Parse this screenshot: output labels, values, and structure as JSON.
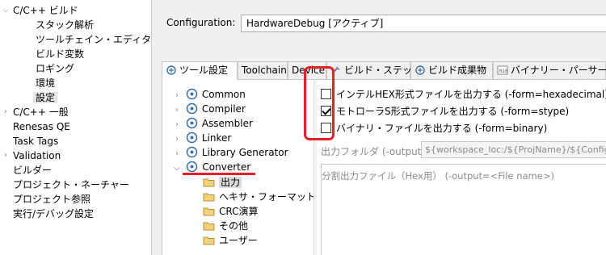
{
  "left_tree": {
    "items": [
      {
        "label": "C/C++ ビルド",
        "expanded": true
      },
      {
        "label": "スタック解析"
      },
      {
        "label": "ツールチェイン・エディター"
      },
      {
        "label": "ビルド変数"
      },
      {
        "label": "ロギング"
      },
      {
        "label": "環境"
      },
      {
        "label": "設定",
        "selected": true
      },
      {
        "label": "C/C++ 一般"
      },
      {
        "label": "Renesas QE"
      },
      {
        "label": "Task Tags"
      },
      {
        "label": "Validation"
      },
      {
        "label": "ビルダー"
      },
      {
        "label": "プロジェクト・ネーチャー"
      },
      {
        "label": "プロジェクト参照"
      },
      {
        "label": "実行/デバッグ設定"
      }
    ]
  },
  "configuration": {
    "label": "Configuration:",
    "value": "HardwareDebug  [アクティブ]"
  },
  "tabs": [
    {
      "label": "ツール設定",
      "active": true,
      "icon": "tool-settings-icon"
    },
    {
      "label": "Toolchain"
    },
    {
      "label": "Device"
    },
    {
      "label": "ビルド・ステップ",
      "icon": "build-steps-icon"
    },
    {
      "label": "ビルド成果物",
      "icon": "build-artifact-icon"
    },
    {
      "label": "バイナリー・パーサー",
      "icon": "binary-parser-icon"
    }
  ],
  "tool_tree": {
    "items": [
      {
        "label": "Common"
      },
      {
        "label": "Compiler"
      },
      {
        "label": "Assembler"
      },
      {
        "label": "Linker"
      },
      {
        "label": "Library Generator"
      },
      {
        "label": "Converter",
        "expanded": true
      },
      {
        "label": "出力",
        "selected": true
      },
      {
        "label": "ヘキサ・フォーマット"
      },
      {
        "label": "CRC演算"
      },
      {
        "label": "その他"
      },
      {
        "label": "ユーザー"
      }
    ]
  },
  "options": [
    {
      "label": "インテルHEX形式ファイルを出力する (-form=hexadecimal)",
      "checked": false
    },
    {
      "label": "モトローラS形式ファイルを出力する (-form=stype)",
      "checked": true
    },
    {
      "label": "バイナリ・ファイルを出力する (-form=binary)",
      "checked": false
    }
  ],
  "output_folder": {
    "label": "出力フォルダ (-output)",
    "value": "${workspace_loc:/${ProjName}/${ConfigNa"
  },
  "split_output": {
    "label": "分割出力ファイル（Hex用） (-output=<File name>)"
  },
  "colors": {
    "annotation": "#e8202a",
    "selection": "#dcdcdc"
  }
}
